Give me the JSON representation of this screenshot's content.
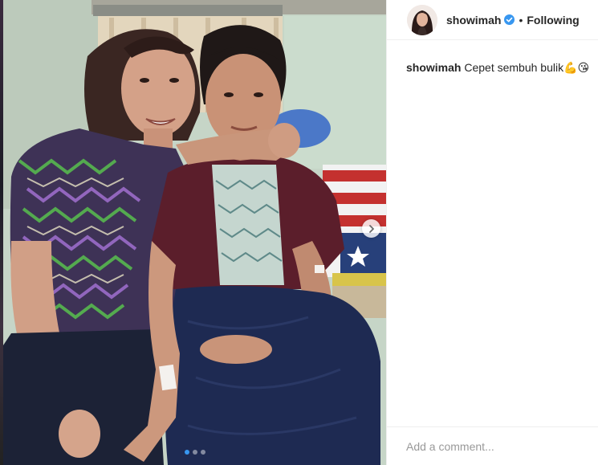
{
  "post": {
    "username": "showimah",
    "verified": true,
    "separator": "•",
    "follow_status": "Following",
    "caption": {
      "username": "showimah",
      "text": "Cepet sembuh bulik",
      "emojis": "💪😘"
    },
    "comment_placeholder": "Add a comment...",
    "carousel": {
      "slide_count": 3,
      "active_index": 0
    }
  },
  "colors": {
    "accent_blue": "#3897f0",
    "verified_badge": "#3897f0",
    "text": "#262626",
    "muted": "#999999",
    "divider": "#efefef"
  },
  "icons": {
    "avatar": "profile-avatar",
    "verified": "verified-badge-icon",
    "next": "chevron-right-icon"
  }
}
